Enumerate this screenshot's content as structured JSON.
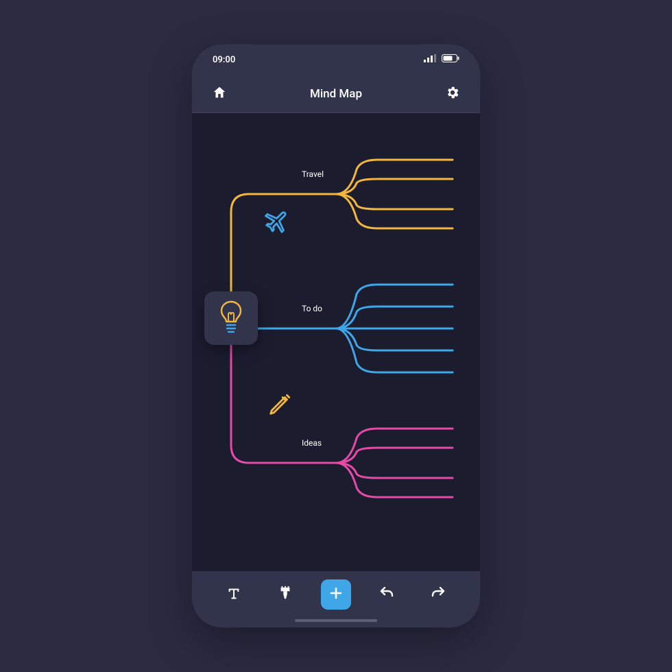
{
  "status": {
    "time": "09:00"
  },
  "nav": {
    "title": "Mind Map"
  },
  "branches": {
    "travel": {
      "label": "Travel",
      "color": "#f3b63e"
    },
    "todo": {
      "label": "To do",
      "color": "#3fa6e8"
    },
    "ideas": {
      "label": "Ideas",
      "color": "#e64aa8"
    }
  },
  "colors": {
    "accent": "#3fa6e8",
    "yellow": "#f3b63e",
    "pink": "#e64aa8",
    "bg": "#2a2b41",
    "phone": "#32344c",
    "canvas": "#1b1c2e"
  },
  "tools": {
    "text": "T",
    "brush": "brush",
    "add": "+",
    "undo": "undo",
    "redo": "redo"
  }
}
